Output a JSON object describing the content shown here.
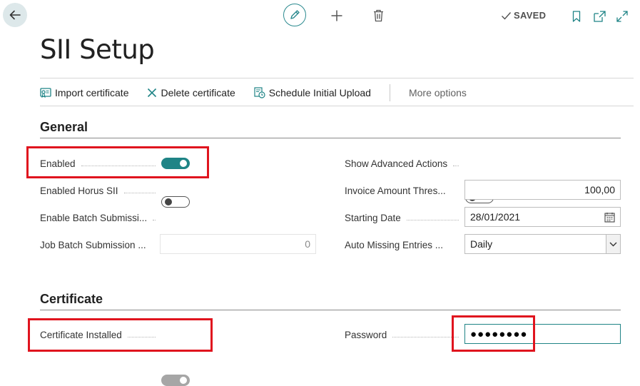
{
  "header": {
    "saved_label": "SAVED",
    "icons": [
      "back-arrow-icon",
      "pencil-icon",
      "plus-icon",
      "trash-icon",
      "checkmark-icon",
      "bookmark-icon",
      "open-new-window-icon",
      "expand-icon"
    ]
  },
  "page": {
    "title": "SII Setup"
  },
  "actions": {
    "import_certificate": "Import certificate",
    "delete_certificate": "Delete certificate",
    "schedule_initial_upload": "Schedule Initial Upload",
    "more_options": "More options"
  },
  "general": {
    "title": "General",
    "enabled": {
      "label": "Enabled",
      "value": true
    },
    "enabled_horus_sii": {
      "label": "Enabled Horus SII",
      "value": false
    },
    "enable_batch_submission": {
      "label": "Enable Batch Submissi...",
      "value": false
    },
    "job_batch_submission": {
      "label": "Job Batch Submission ...",
      "value": "0"
    },
    "show_advanced_actions": {
      "label": "Show Advanced Actions",
      "value": false
    },
    "invoice_amount_threshold": {
      "label": "Invoice Amount Thres...",
      "value": "100,00"
    },
    "starting_date": {
      "label": "Starting Date",
      "value": "28/01/2021"
    },
    "auto_missing_entries": {
      "label": "Auto Missing Entries ...",
      "value": "Daily"
    }
  },
  "certificate": {
    "title": "Certificate",
    "certificate_installed": {
      "label": "Certificate Installed",
      "value": true
    },
    "password": {
      "label": "Password",
      "value": "●●●●●●●●"
    }
  },
  "colors": {
    "accent": "#1f8486",
    "highlight_box": "#e0141e"
  }
}
